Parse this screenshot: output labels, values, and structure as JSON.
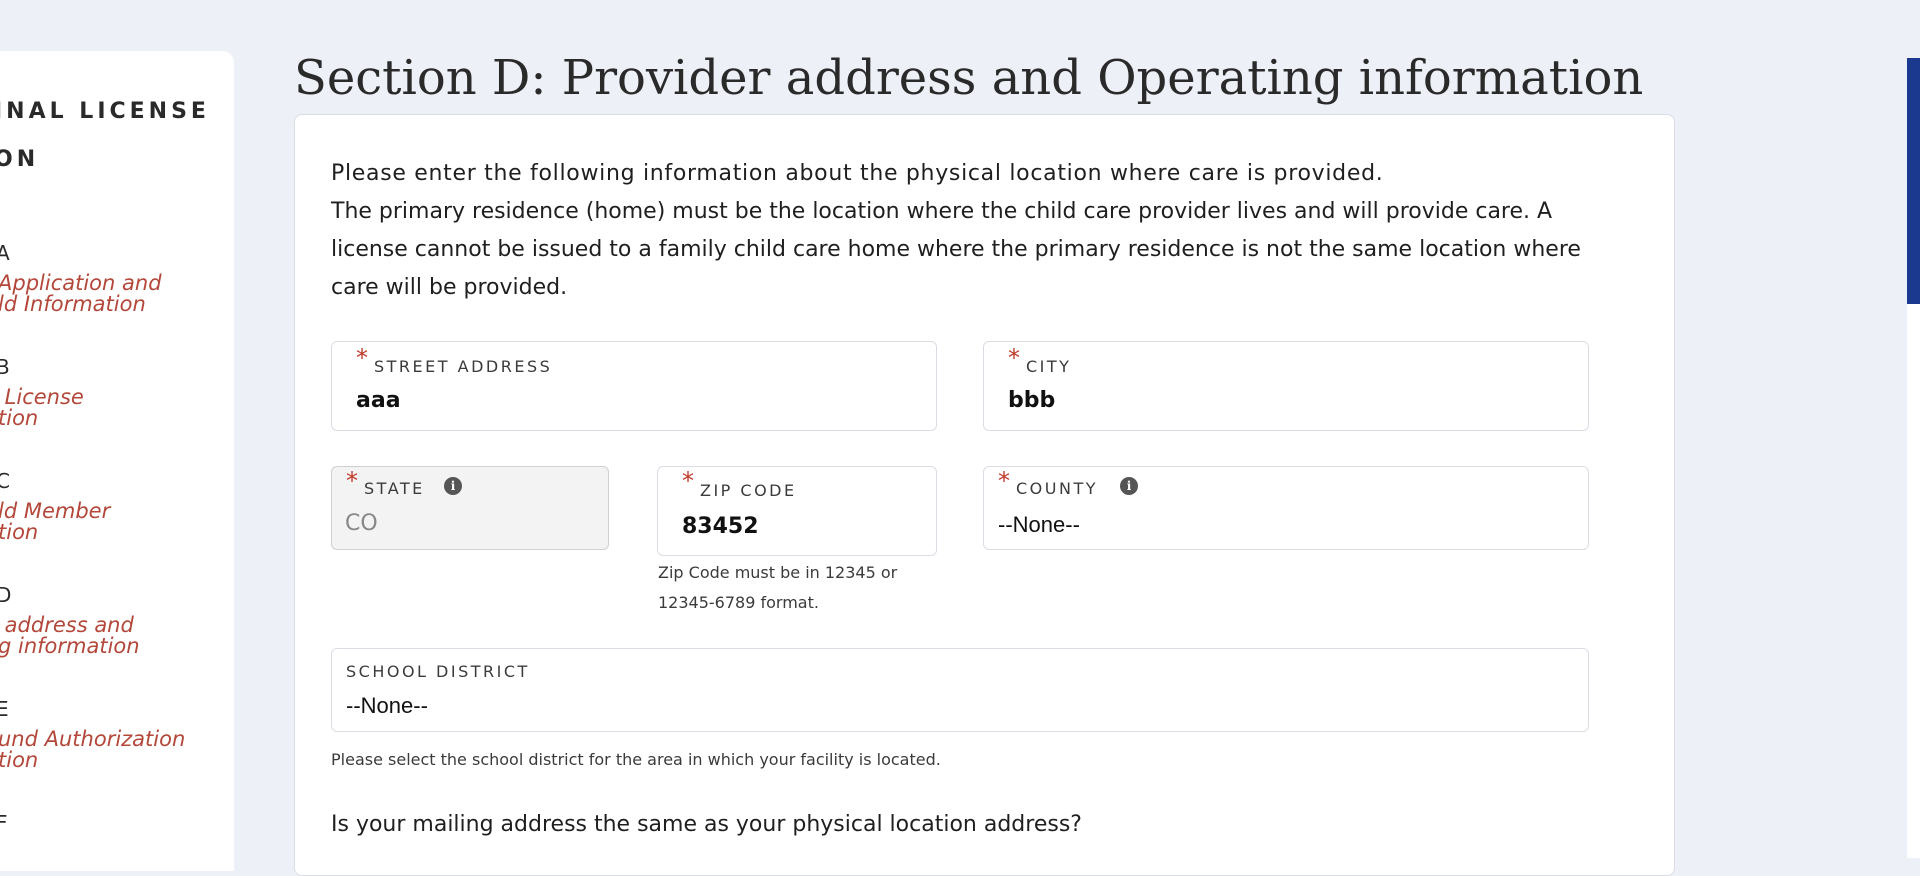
{
  "sidebar": {
    "title_line1": "INAL LICENSE",
    "title_line2": "ON",
    "sections": [
      {
        "letter": "A",
        "link_line1": "Application and",
        "link_line2": "ld Information"
      },
      {
        "letter": "B",
        "link_line1": " License",
        "link_line2": "tion"
      },
      {
        "letter": "C",
        "link_line1": "ld Member",
        "link_line2": "tion"
      },
      {
        "letter": "D",
        "link_line1": " address and",
        "link_line2": "g information"
      },
      {
        "letter": "E",
        "link_line1": "und Authorization",
        "link_line2": "tion"
      },
      {
        "letter": "F"
      }
    ]
  },
  "page": {
    "section_title": "Section D: Provider address and Operating information",
    "intro_lead": "Please enter the following information about the physical location where care is provided.",
    "intro_body": "The primary residence (home) must be the location where the child care provider lives and will provide care. A license cannot be issued to a family child care home where the primary residence is not the same location where care will be provided."
  },
  "form": {
    "street": {
      "required": "*",
      "label": "STREET ADDRESS",
      "value": "aaa"
    },
    "city": {
      "required": "*",
      "label": "CITY",
      "value": "bbb"
    },
    "state": {
      "required": "*",
      "label": "STATE",
      "value": "CO",
      "info": "i"
    },
    "zip": {
      "required": "*",
      "label": "ZIP CODE",
      "value": "83452",
      "help": "Zip Code must be in 12345 or 12345-6789 format."
    },
    "county": {
      "required": "*",
      "label": "COUNTY",
      "value": "--None--",
      "info": "i"
    },
    "school_district": {
      "label": "SCHOOL DISTRICT",
      "value": "--None--",
      "help": "Please select the school district for the area in which your facility is located."
    },
    "mailing_question": "Is your mailing address the same as your physical location address?"
  },
  "colors": {
    "background": "#eef0f7",
    "required": "#c0392b",
    "sidebar_link": "#b3473a",
    "scrollbar": "#1b3a8f"
  }
}
